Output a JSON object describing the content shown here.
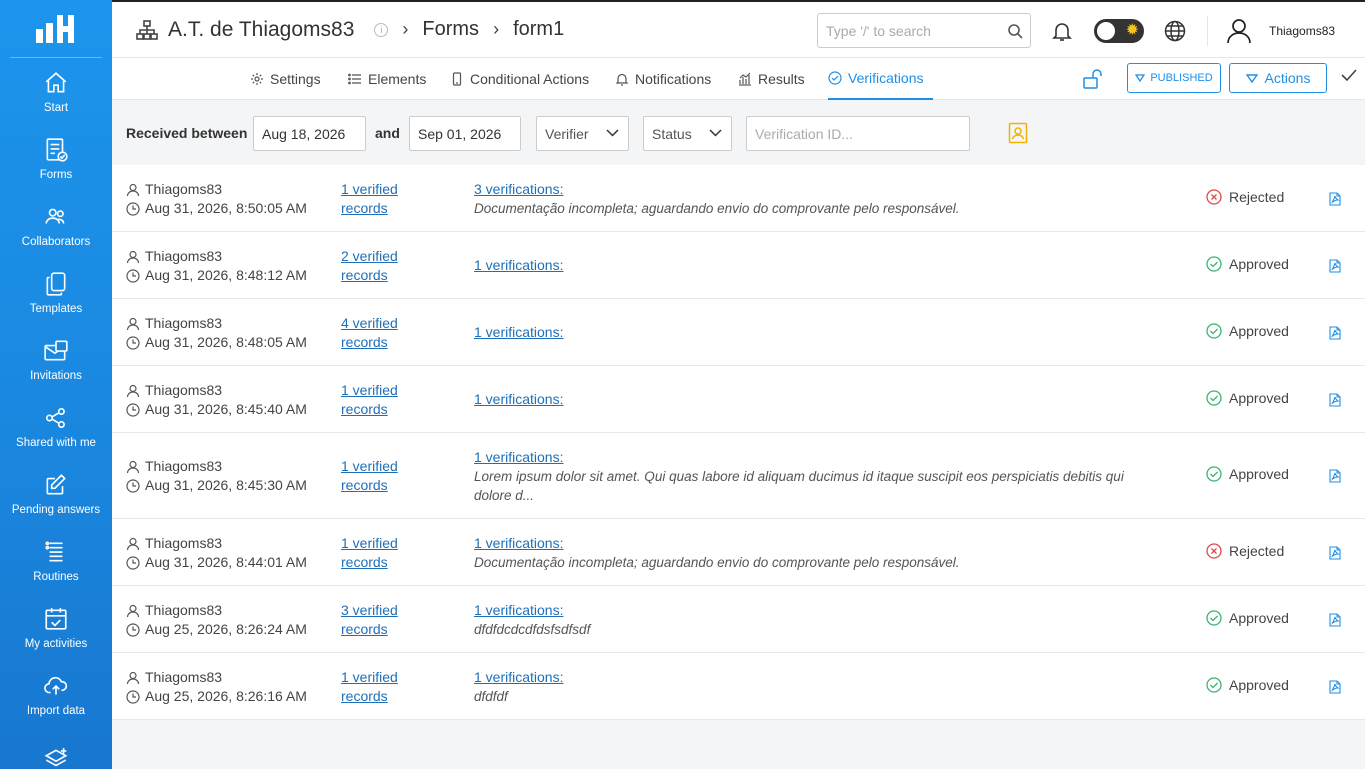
{
  "sidebar": {
    "items": [
      {
        "label": "Start",
        "icon": "home-icon"
      },
      {
        "label": "Forms",
        "icon": "forms-icon"
      },
      {
        "label": "Collaborators",
        "icon": "collaborators-icon"
      },
      {
        "label": "Templates",
        "icon": "templates-icon"
      },
      {
        "label": "Invitations",
        "icon": "invitations-icon"
      },
      {
        "label": "Shared with me",
        "icon": "share-icon"
      },
      {
        "label": "Pending answers",
        "icon": "edit-icon"
      },
      {
        "label": "Routines",
        "icon": "routines-icon"
      },
      {
        "label": "My activities",
        "icon": "calendar-check-icon"
      },
      {
        "label": "Import data",
        "icon": "cloud-upload-icon"
      },
      {
        "label": "",
        "icon": "layers-icon"
      }
    ]
  },
  "header": {
    "workspace": "A.T. de Thiagoms83",
    "crumb_forms": "Forms",
    "crumb_form": "form1",
    "search_placeholder": "Type '/' to search",
    "username": "Thiagoms83"
  },
  "tabs": [
    {
      "label": "Settings",
      "icon": "gear-icon",
      "active": false
    },
    {
      "label": "Elements",
      "icon": "list-icon",
      "active": false
    },
    {
      "label": "Conditional Actions",
      "icon": "phone-icon",
      "active": false
    },
    {
      "label": "Notifications",
      "icon": "bell-icon",
      "active": false
    },
    {
      "label": "Results",
      "icon": "bar-chart-icon",
      "active": false
    },
    {
      "label": "Verifications",
      "icon": "check-circle-icon",
      "active": true
    }
  ],
  "toolbar": {
    "published_label": "PUBLISHED",
    "actions_label": "Actions"
  },
  "filters": {
    "received_label": "Received between",
    "date_from": "Aug 18, 2026",
    "and_label": "and",
    "date_to": "Sep 01, 2026",
    "verifier_label": "Verifier",
    "status_label": "Status",
    "verification_id_placeholder": "Verification ID..."
  },
  "records": [
    {
      "user": "Thiagoms83",
      "datetime": "Aug 31, 2026, 8:50:05 AM",
      "verified_records": "1 verified records",
      "verifications": "3 verifications:",
      "comment": "Documentação incompleta; aguardando envio do comprovante pelo responsável.",
      "status": "Rejected"
    },
    {
      "user": "Thiagoms83",
      "datetime": "Aug 31, 2026, 8:48:12 AM",
      "verified_records": "2 verified records",
      "verifications": "1 verifications:",
      "comment": "",
      "status": "Approved"
    },
    {
      "user": "Thiagoms83",
      "datetime": "Aug 31, 2026, 8:48:05 AM",
      "verified_records": "4 verified records",
      "verifications": "1 verifications:",
      "comment": "",
      "status": "Approved"
    },
    {
      "user": "Thiagoms83",
      "datetime": "Aug 31, 2026, 8:45:40 AM",
      "verified_records": "1 verified records",
      "verifications": "1 verifications:",
      "comment": "",
      "status": "Approved"
    },
    {
      "user": "Thiagoms83",
      "datetime": "Aug 31, 2026, 8:45:30 AM",
      "verified_records": "1 verified records",
      "verifications": "1 verifications:",
      "comment": "Lorem ipsum dolor sit amet. Qui quas labore id aliquam ducimus id itaque suscipit eos perspiciatis debitis qui dolore d...",
      "status": "Approved"
    },
    {
      "user": "Thiagoms83",
      "datetime": "Aug 31, 2026, 8:44:01 AM",
      "verified_records": "1 verified records",
      "verifications": "1 verifications:",
      "comment": "Documentação incompleta; aguardando envio do comprovante pelo responsável.",
      "status": "Rejected"
    },
    {
      "user": "Thiagoms83",
      "datetime": "Aug 25, 2026, 8:26:24 AM",
      "verified_records": "3 verified records",
      "verifications": "1 verifications:",
      "comment": "dfdfdcdcdfdsfsdfsdf",
      "status": "Approved"
    },
    {
      "user": "Thiagoms83",
      "datetime": "Aug 25, 2026, 8:26:16 AM",
      "verified_records": "1 verified records",
      "verifications": "1 verifications:",
      "comment": "dfdfdf",
      "status": "Approved"
    }
  ],
  "colors": {
    "sidebar": "#1a86de",
    "accent": "#1e8fe6",
    "link": "#1e6fb8",
    "approved": "#3cb371",
    "rejected": "#e04848",
    "contact_icon": "#f0b400"
  }
}
